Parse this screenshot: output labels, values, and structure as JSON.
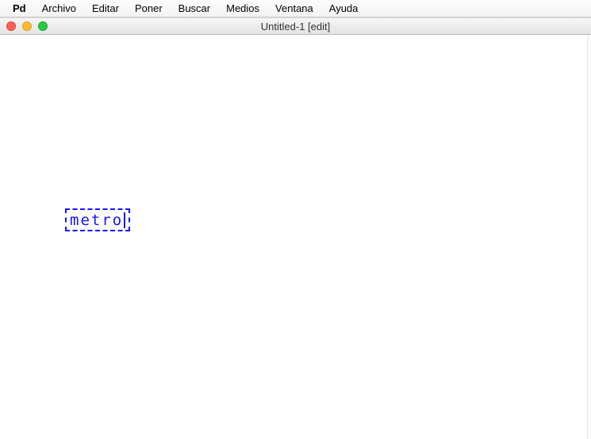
{
  "menubar": {
    "app": "Pd",
    "items": [
      "Archivo",
      "Editar",
      "Poner",
      "Buscar",
      "Medios",
      "Ventana",
      "Ayuda"
    ]
  },
  "titlebar": {
    "title": "Untitled-1 [edit]"
  },
  "canvas": {
    "object_text": "metro"
  },
  "colors": {
    "selection_blue": "#1414ff"
  }
}
